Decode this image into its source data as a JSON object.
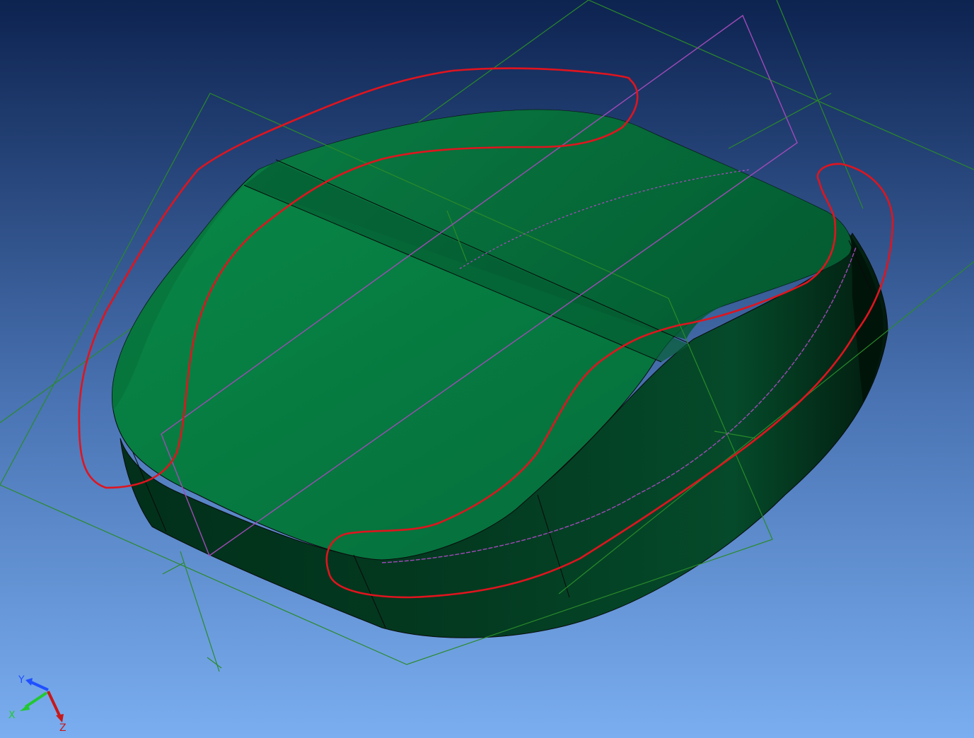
{
  "viewport": {
    "background_top": "#0d2350",
    "background_bottom": "#7aaef0"
  },
  "model": {
    "face_color": "#067a40",
    "face_shade_color": "#05683a",
    "side_color": "#03361e",
    "edge_color": "#0a0a0a"
  },
  "reference_planes": {
    "color": "#2a8a2a"
  },
  "highlight_curve": {
    "color": "#a04ab8"
  },
  "annotation": {
    "color": "#e0141e"
  },
  "axis_triad": {
    "x_label": "X",
    "y_label": "Y",
    "z_label": "Z",
    "x_color": "#22c830",
    "y_color": "#2050ff",
    "z_color": "#c81818"
  }
}
